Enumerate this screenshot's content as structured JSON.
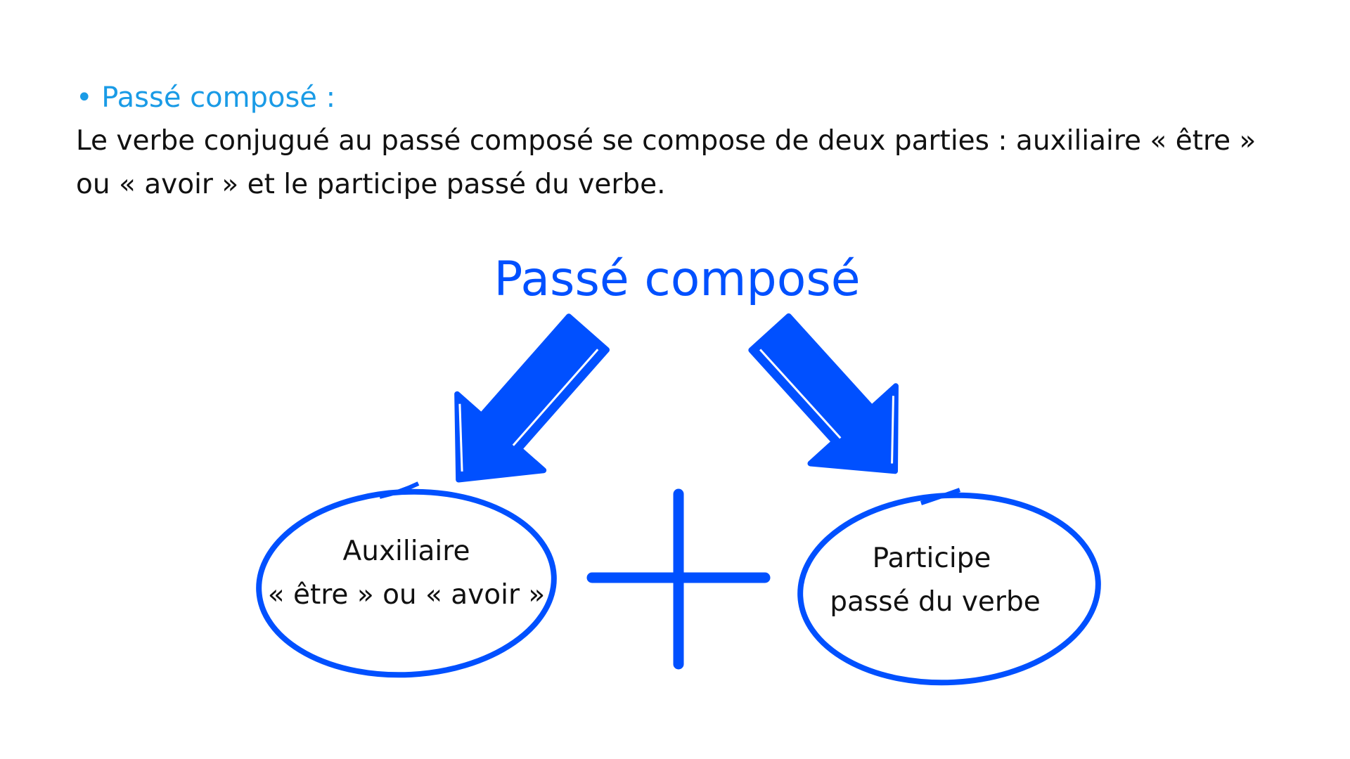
{
  "section": {
    "heading": "• Passé composé :",
    "body_lines": [
      "Le verbe conjugué au passé composé se compose de deux parties : auxiliaire « être »",
      "ou « avoir » et le participe passé du verbe."
    ]
  },
  "diagram": {
    "title": "Passé composé",
    "left_box": {
      "line1": "Auxiliaire",
      "line2": "« être » ou « avoir »"
    },
    "operator_icon": "plus-icon",
    "right_box": {
      "line1": "Participe",
      "line2": "passé du verbe"
    },
    "colors": {
      "accent": "#0050ff",
      "heading": "#1a9be6",
      "text": "#111111"
    }
  }
}
